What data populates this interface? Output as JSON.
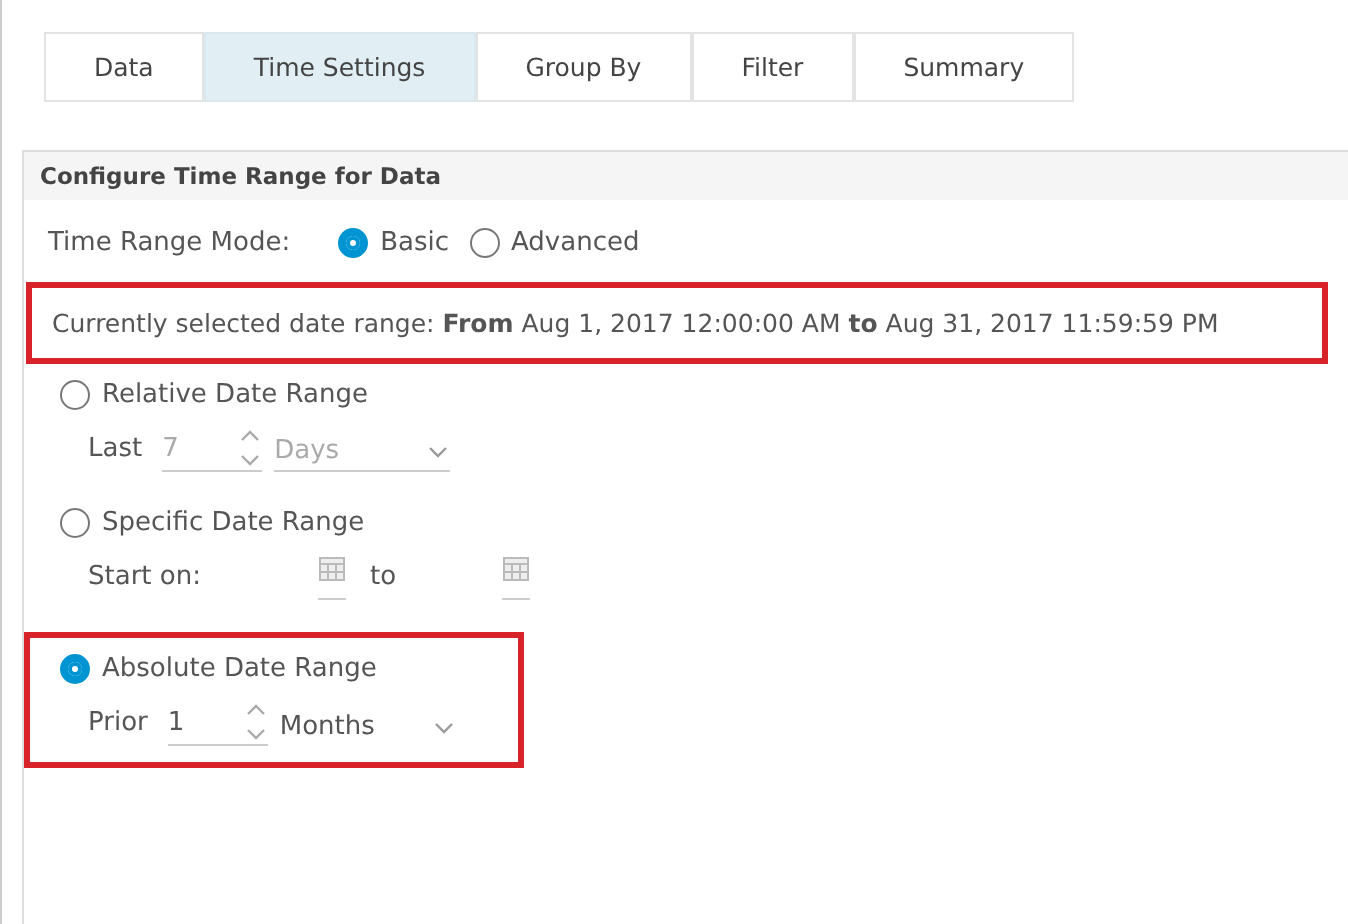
{
  "tabs": [
    {
      "label": "Data",
      "selected": false
    },
    {
      "label": "Time Settings",
      "selected": true
    },
    {
      "label": "Group By",
      "selected": false
    },
    {
      "label": "Filter",
      "selected": false
    },
    {
      "label": "Summary",
      "selected": false
    }
  ],
  "panel": {
    "title": "Configure Time Range for Data",
    "mode": {
      "label": "Time Range Mode:",
      "options": [
        {
          "label": "Basic",
          "selected": true
        },
        {
          "label": "Advanced",
          "selected": false
        }
      ]
    },
    "summary": {
      "text": "Currently selected date range: **From** Aug 1, 2017 12:00:00 AM **to** Aug 31, 2017 11:59:59 PM",
      "highlighted": true
    },
    "ranges": [
      {
        "kind": "count",
        "label": "Relative Date Range",
        "selected": false,
        "highlighted": false,
        "prefix": "Last",
        "value": "7",
        "unit": "Days"
      },
      {
        "kind": "dates",
        "label": "Specific Date Range",
        "selected": false,
        "highlighted": false,
        "prefix": "Start on:",
        "separator": "to"
      },
      {
        "kind": "count",
        "label": "Absolute Date Range",
        "selected": true,
        "highlighted": true,
        "prefix": "Prior",
        "value": "1",
        "unit": "Months"
      }
    ]
  }
}
